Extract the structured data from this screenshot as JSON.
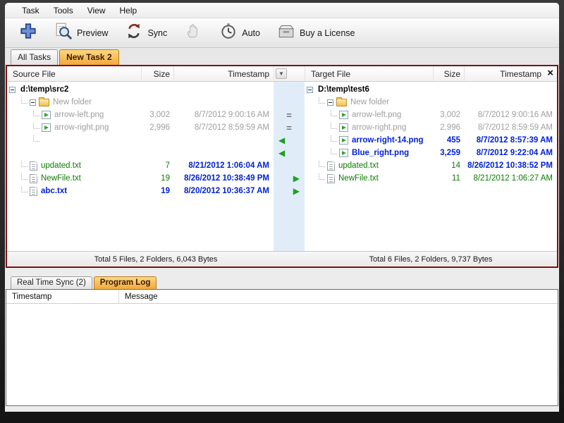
{
  "menu": {
    "items": [
      "Task",
      "Tools",
      "View",
      "Help"
    ]
  },
  "toolbar": {
    "preview": "Preview",
    "sync": "Sync",
    "auto": "Auto",
    "buy": "Buy a License"
  },
  "task_tabs": {
    "all": "All Tasks",
    "current": "New Task 2"
  },
  "sync_panel": {
    "columns": {
      "source": "Source File",
      "target": "Target File",
      "size": "Size",
      "timestamp": "Timestamp"
    },
    "source_total": "Total 5 Files, 2 Folders, 6,043 Bytes",
    "target_total": "Total 6 Files, 2 Folders, 9,737 Bytes",
    "rows": [
      {
        "left": {
          "type": "root",
          "name": "d:\\temp\\src2"
        },
        "mid": "",
        "right": {
          "type": "root",
          "name": "D:\\temp\\test6"
        }
      },
      {
        "left": {
          "type": "folder",
          "name": "New folder",
          "color": "gray",
          "indent": 1
        },
        "mid": "",
        "right": {
          "type": "folder",
          "name": "New folder",
          "color": "gray",
          "indent": 1
        }
      },
      {
        "left": {
          "type": "img",
          "name": "arrow-left.png",
          "size": "3,002",
          "ts": "8/7/2012 9:00:16 AM",
          "color": "gray",
          "indent": 2
        },
        "mid": "eq",
        "right": {
          "type": "img",
          "name": "arrow-left.png",
          "size": "3,002",
          "ts": "8/7/2012 9:00:16 AM",
          "color": "gray",
          "indent": 2
        }
      },
      {
        "left": {
          "type": "img",
          "name": "arrow-right.png",
          "size": "2,996",
          "ts": "8/7/2012 8:59:59 AM",
          "color": "gray",
          "indent": 2
        },
        "mid": "eq",
        "right": {
          "type": "img",
          "name": "arrow-right.png",
          "size": "2,996",
          "ts": "8/7/2012 8:59:59 AM",
          "color": "gray",
          "indent": 2
        }
      },
      {
        "left": {
          "type": "stub",
          "indent": 2
        },
        "mid": "left",
        "right": {
          "type": "img",
          "name": "arrow-right-14.png",
          "size": "455",
          "ts": "8/7/2012 8:57:39 AM",
          "color": "blue",
          "indent": 2
        }
      },
      {
        "left": null,
        "mid": "left",
        "right": {
          "type": "img",
          "name": "Blue_right.png",
          "size": "3,259",
          "ts": "8/7/2012 9:22:04 AM",
          "color": "blue",
          "indent": 2
        }
      },
      {
        "left": {
          "type": "txt",
          "name": "updated.txt",
          "size": "7",
          "ts": "8/21/2012 1:06:04 AM",
          "color": "green",
          "tsColor": "blue",
          "indent": 1
        },
        "mid": "",
        "right": {
          "type": "txt",
          "name": "updated.txt",
          "size": "14",
          "ts": "8/26/2012 10:38:52 PM",
          "color": "green",
          "tsColor": "blue",
          "indent": 1
        }
      },
      {
        "left": {
          "type": "txt",
          "name": "NewFile.txt",
          "size": "19",
          "ts": "8/26/2012 10:38:49 PM",
          "color": "green",
          "tsColor": "blue",
          "indent": 1
        },
        "mid": "right",
        "right": {
          "type": "txt",
          "name": "NewFile.txt",
          "size": "11",
          "ts": "8/21/2012 1:06:27 AM",
          "color": "green",
          "tsColor": "green",
          "indent": 1
        }
      },
      {
        "left": {
          "type": "txt",
          "name": "abc.txt",
          "size": "19",
          "ts": "8/20/2012 10:36:37 AM",
          "color": "blue",
          "tsColor": "blue",
          "indent": 1
        },
        "mid": "right",
        "right": null
      }
    ]
  },
  "bottom_tabs": {
    "realtime": "Real Time Sync (2)",
    "log": "Program Log"
  },
  "log": {
    "columns": {
      "timestamp": "Timestamp",
      "message": "Message"
    }
  },
  "icons": {
    "close": "×",
    "sort": "▼",
    "equal": "=",
    "left": "◀",
    "right": "▶"
  },
  "colors": {
    "green": "#0a7d00",
    "blue": "#0021d4",
    "gray": "#9e9e9e",
    "active_tab": "#f2a93c",
    "panel_border": "#7c1113"
  }
}
